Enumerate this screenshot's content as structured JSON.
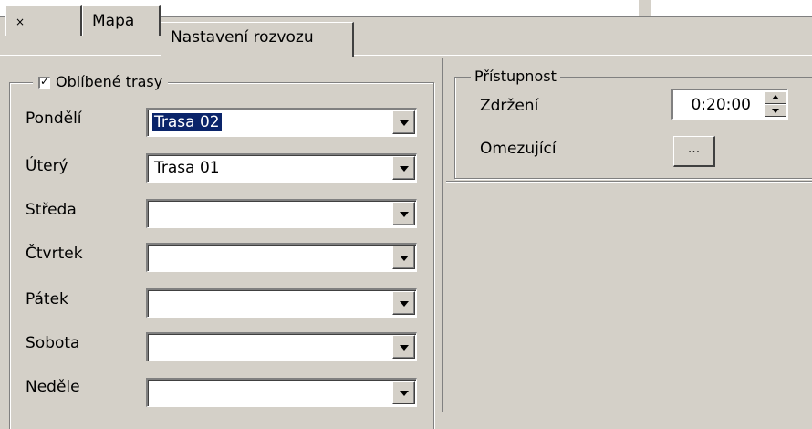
{
  "tabs": [
    {
      "label": "×"
    },
    {
      "label": "Mapa"
    },
    {
      "label": "Nastavení rozvozu"
    }
  ],
  "favorites": {
    "checkbox_label": "Oblíbené trasy",
    "checked": true,
    "days": [
      {
        "label": "Pondělí",
        "value": "Trasa 02",
        "selected": true
      },
      {
        "label": "Úterý",
        "value": "Trasa 01",
        "selected": false
      },
      {
        "label": "Středa",
        "value": "",
        "selected": false
      },
      {
        "label": "Čtvrtek",
        "value": "",
        "selected": false
      },
      {
        "label": "Pátek",
        "value": "",
        "selected": false
      },
      {
        "label": "Sobota",
        "value": "",
        "selected": false
      },
      {
        "label": "Neděle",
        "value": "",
        "selected": false
      }
    ]
  },
  "access": {
    "legend": "Přístupnost",
    "delay_label": "Zdržení",
    "delay_value": "0:20:00",
    "restricting_label": "Omezující",
    "restricting_button": "..."
  },
  "colors": {
    "face": "#d4d0c8",
    "selection": "#0a246a"
  }
}
